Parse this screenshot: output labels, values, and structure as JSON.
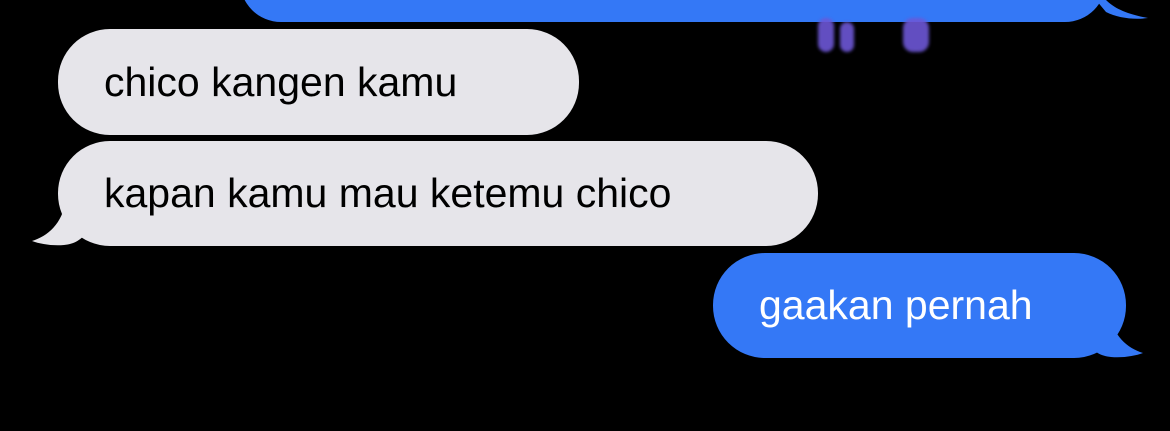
{
  "colors": {
    "background": "#000000",
    "incoming_bubble": "#e6e5ea",
    "incoming_text": "#000000",
    "outgoing_bubble": "#3478f6",
    "outgoing_text": "#ffffff",
    "image_fragment": "#6d57d6"
  },
  "messages": [
    {
      "direction": "outgoing",
      "text": "",
      "partially_visible": true
    },
    {
      "direction": "incoming",
      "text": "chico kangen kamu"
    },
    {
      "direction": "incoming",
      "text": "kapan kamu mau ketemu chico"
    },
    {
      "direction": "outgoing",
      "text": "gaakan pernah"
    }
  ]
}
